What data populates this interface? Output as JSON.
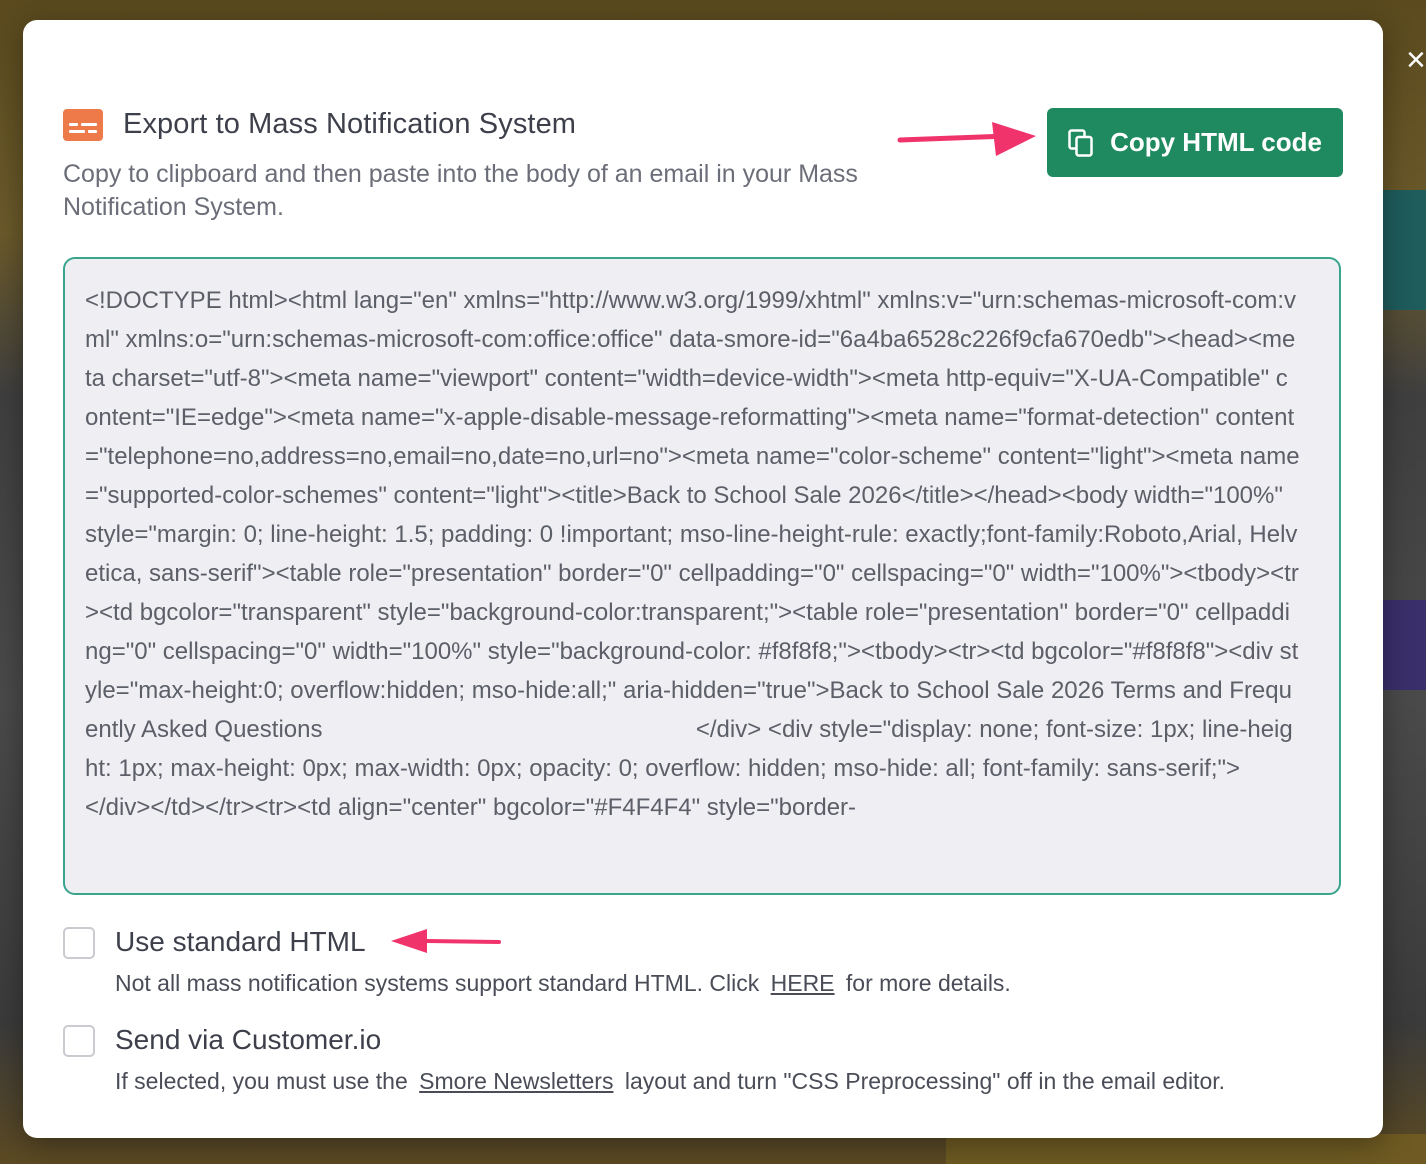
{
  "dialog": {
    "title": "Export to Mass Notification System",
    "subtitle": "Copy to clipboard and then paste into the body of an email in your Mass Notification System.",
    "copy_button_label": "Copy HTML code",
    "close_label": "×",
    "code": "<!DOCTYPE html><html lang=\"en\" xmlns=\"http://www.w3.org/1999/xhtml\" xmlns:v=\"urn:schemas-microsoft-com:vml\" xmlns:o=\"urn:schemas-microsoft-com:office:office\" data-smore-id=\"6a4ba6528c226f9cfa670edb\"><head><meta charset=\"utf-8\"><meta name=\"viewport\" content=\"width=device-width\"><meta http-equiv=\"X-UA-Compatible\" content=\"IE=edge\"><meta name=\"x-apple-disable-message-reformatting\"><meta name=\"format-detection\" content=\"telephone=no,address=no,email=no,date=no,url=no\"><meta name=\"color-scheme\" content=\"light\"><meta name=\"supported-color-schemes\" content=\"light\"><title>Back to School Sale 2026</title></head><body width=\"100%\" style=\"margin: 0; line-height: 1.5; padding: 0 !important; mso-line-height-rule: exactly;font-family:Roboto,Arial, Helvetica, sans-serif\"><table role=\"presentation\" border=\"0\" cellpadding=\"0\" cellspacing=\"0\" width=\"100%\"><tbody><tr><td bgcolor=\"transparent\" style=\"background-color:transparent;\"><table role=\"presentation\" border=\"0\" cellpadding=\"0\" cellspacing=\"0\" width=\"100%\" style=\"background-color: #f8f8f8;\"><tbody><tr><td bgcolor=\"#f8f8f8\"><div style=\"max-height:0; overflow:hidden; mso-hide:all;\" aria-hidden=\"true\">Back to School Sale 2026 Terms and Frequently Asked Questions                                                        </div> <div style=\"display: none; font-size: 1px; line-height: 1px; max-height: 0px; max-width: 0px; opacity: 0; overflow: hidden; mso-hide: all; font-family: sans-serif;\">               </div></td></tr><tr><td align=\"center\" bgcolor=\"#F4F4F4\" style=\"border-"
  },
  "options": [
    {
      "label": "Use standard HTML",
      "desc_before": "Not all mass notification systems support standard HTML. Click",
      "link": "HERE",
      "desc_after": "for more details."
    },
    {
      "label": "Send via Customer.io",
      "desc_before": "If selected, you must use the",
      "link": "Smore Newsletters",
      "desc_after": "layout and turn \"CSS Preprocessing\" off in the email editor."
    }
  ],
  "colors": {
    "accent_green": "#1f8a5f",
    "icon_orange": "#ee7a4a",
    "arrow_pink": "#f0336b",
    "code_border": "#3aa58d"
  },
  "icons": [
    "export-icon",
    "copy-icon",
    "close-icon"
  ]
}
